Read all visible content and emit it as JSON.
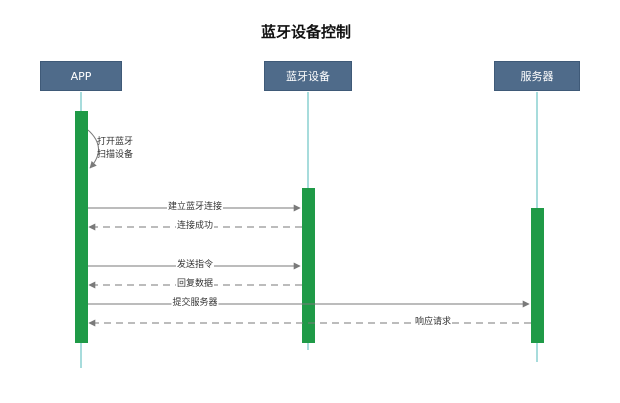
{
  "title": "蓝牙设备控制",
  "actors": [
    {
      "label": "APP"
    },
    {
      "label": "蓝牙设备"
    },
    {
      "label": "服务器"
    }
  ],
  "messages": [
    {
      "label": "打开蓝牙\n扫描设备",
      "kind": "self"
    },
    {
      "label": "建立蓝牙连接",
      "from": "APP",
      "to": "蓝牙设备",
      "style": "solid"
    },
    {
      "label": "连接成功",
      "from": "蓝牙设备",
      "to": "APP",
      "style": "dashed"
    },
    {
      "label": "发送指令",
      "from": "APP",
      "to": "蓝牙设备",
      "style": "solid"
    },
    {
      "label": "回复数据",
      "from": "蓝牙设备",
      "to": "APP",
      "style": "dashed"
    },
    {
      "label": "提交服务器",
      "from": "APP",
      "to": "服务器",
      "style": "solid"
    },
    {
      "label": "响应请求",
      "from": "服务器",
      "to": "APP",
      "style": "dashed"
    }
  ],
  "colors": {
    "actor_fill": "#4f6b8a",
    "lifeline": "#4fb8b8",
    "activation": "#1f9a47",
    "arrow": "#7a7a7a"
  }
}
